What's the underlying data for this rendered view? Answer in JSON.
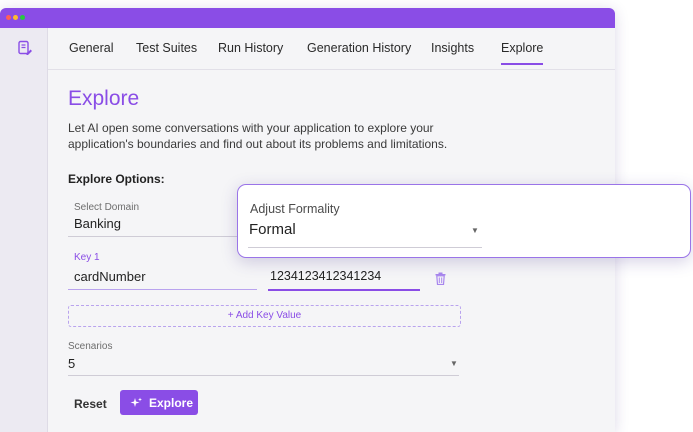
{
  "tabs": [
    "General",
    "Test Suites",
    "Run History",
    "Generation History",
    "Insights",
    "Explore"
  ],
  "page": {
    "title": "Explore",
    "description": "Let AI open some conversations with your application to explore your application's boundaries and find out about its problems and limitations.",
    "options_heading": "Explore Options:"
  },
  "domain": {
    "label": "Select Domain",
    "value": "Banking"
  },
  "key_value": {
    "key_label": "Key 1",
    "key_value": "cardNumber",
    "value_value": "1234123412341234"
  },
  "add_key_value": "+ Add Key Value",
  "scenarios": {
    "label": "Scenarios",
    "value": "5"
  },
  "buttons": {
    "reset": "Reset",
    "explore": "Explore"
  },
  "formality_popup": {
    "label": "Adjust Formality",
    "value": "Formal"
  },
  "colors": {
    "accent": "#8a4de6"
  }
}
